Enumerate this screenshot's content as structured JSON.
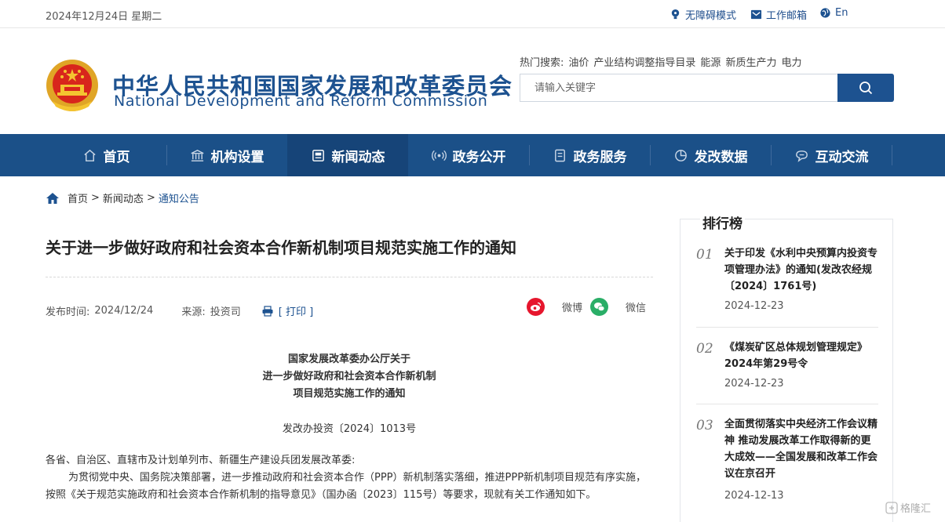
{
  "topbar": {
    "date": "2024年12月24日 星期二",
    "accessibility": "无障碍模式",
    "mailbox": "工作邮箱",
    "lang": "En"
  },
  "header": {
    "name_cn": "中华人民共和国国家发展和改革委员会",
    "name_en": "National Development and Reform Commission",
    "hot_label": "热门搜索:",
    "hot_keywords": [
      "油价",
      "产业结构调整指导目录",
      "能源",
      "新质生产力",
      "电力"
    ],
    "search_placeholder": "请输入关键字"
  },
  "nav": {
    "items": [
      {
        "label": "首页",
        "icon": "home-icon"
      },
      {
        "label": "机构设置",
        "icon": "institution-icon"
      },
      {
        "label": "新闻动态",
        "icon": "news-icon"
      },
      {
        "label": "政务公开",
        "icon": "broadcast-icon"
      },
      {
        "label": "政务服务",
        "icon": "document-icon"
      },
      {
        "label": "发改数据",
        "icon": "pie-chart-icon"
      },
      {
        "label": "互动交流",
        "icon": "chat-icon"
      }
    ],
    "active_index": 2
  },
  "breadcrumb": {
    "home": "首页",
    "level2": "新闻动态",
    "current": "通知公告"
  },
  "article": {
    "title": "关于进一步做好政府和社会资本合作新机制项目规范实施工作的通知",
    "publish_label": "发布时间:",
    "publish_date": "2024/12/24",
    "source_label": "来源:",
    "source": "投资司",
    "print": "[ 打印 ]",
    "share_weibo": "微博",
    "share_wechat": "微信",
    "doc_head": [
      "国家发展改革委办公厅关于",
      "进一步做好政府和社会资本合作新机制",
      "项目规范实施工作的通知"
    ],
    "doc_no": "发改办投资〔2024〕1013号",
    "recipients": "各省、自治区、直辖市及计划单列市、新疆生产建设兵团发展改革委:",
    "paragraph1": "为贯彻党中央、国务院决策部署，进一步推动政府和社会资本合作（PPP）新机制落实落细，推进PPP新机制项目规范有序实施，按照《关于规范实施政府和社会资本合作新机制的指导意见》（国办函〔2023〕115号）等要求，现就有关工作通知如下。"
  },
  "sidebar": {
    "heading": "排行榜",
    "items": [
      {
        "num": "01",
        "title": "关于印发《水利中央预算内投资专项管理办法》的通知(发改农经规〔2024〕1761号)",
        "date": "2024-12-23"
      },
      {
        "num": "02",
        "title": "《煤炭矿区总体规划管理规定》2024年第29号令",
        "date": "2024-12-23"
      },
      {
        "num": "03",
        "title": "全面贯彻落实中央经济工作会议精神 推动发展改革工作取得新的更大成效——全国发展和改革工作会议在京召开",
        "date": "2024-12-13"
      }
    ]
  },
  "watermark": "格隆汇",
  "colors": {
    "brand": "#1d5290",
    "nav_bg": "#1b5088",
    "weibo": "#e6162d",
    "wechat": "#2aae67"
  }
}
